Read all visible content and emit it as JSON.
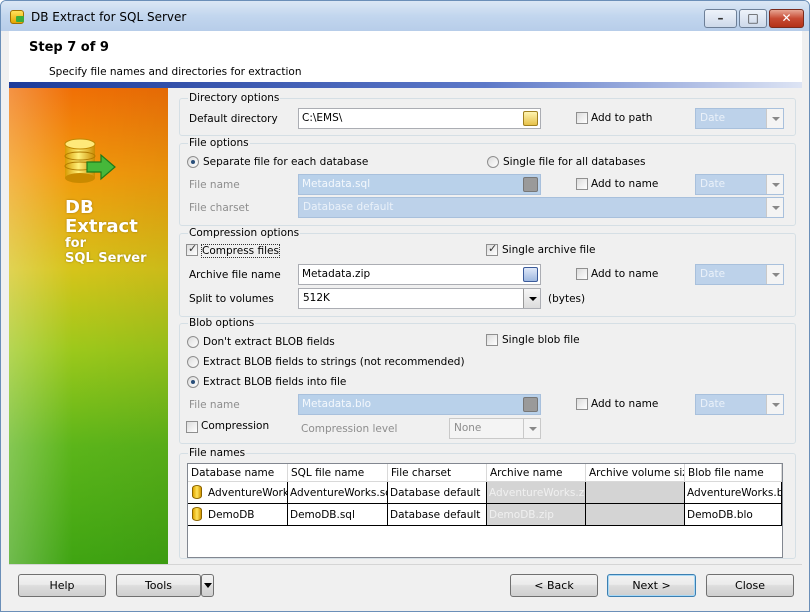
{
  "window": {
    "title": "DB Extract for SQL Server"
  },
  "header": {
    "step": "Step 7 of 9",
    "description": "Specify file names and directories for extraction"
  },
  "banner": {
    "line1": "DB",
    "line2": "Extract",
    "line3": "for",
    "line4": "SQL Server"
  },
  "directory_options": {
    "title": "Directory options",
    "default_directory_label": "Default directory",
    "default_directory_value": "C:\\EMS\\",
    "add_to_path_label": "Add to path",
    "add_to_path_checked": false,
    "date_value": "Date"
  },
  "file_options": {
    "title": "File options",
    "separate_label": "Separate file for each database",
    "single_label": "Single file for all databases",
    "separate_selected": true,
    "file_name_label": "File name",
    "file_name_value": "Metadata.sql",
    "add_to_name_label": "Add to name",
    "date_value": "Date",
    "file_charset_label": "File charset",
    "file_charset_value": "Database default"
  },
  "compression_options": {
    "title": "Compression options",
    "compress_files_label": "Compress files",
    "compress_files_checked": true,
    "single_archive_label": "Single archive file",
    "single_archive_checked": true,
    "archive_file_name_label": "Archive file name",
    "archive_file_name_value": "Metadata.zip",
    "add_to_name_label": "Add to name",
    "date_value": "Date",
    "split_label": "Split to volumes",
    "split_value": "512K",
    "bytes_label": "(bytes)"
  },
  "blob_options": {
    "title": "Blob options",
    "dont_extract_label": "Don't extract BLOB fields",
    "to_strings_label": "Extract BLOB fields to strings (not recommended)",
    "into_file_label": "Extract BLOB fields into file",
    "selected": "into_file",
    "single_blob_label": "Single blob file",
    "file_name_label": "File name",
    "file_name_value": "Metadata.blo",
    "add_to_name_label": "Add to name",
    "date_value": "Date",
    "compression_label": "Compression",
    "compression_level_label": "Compression level",
    "compression_level_value": "None"
  },
  "file_names": {
    "title": "File names",
    "columns": [
      "Database name",
      "SQL file name",
      "File charset",
      "Archive name",
      "Archive volume size",
      "Blob file name"
    ],
    "rows": [
      [
        "AdventureWorks",
        "AdventureWorks.sql",
        "Database default",
        "AdventureWorks.zip",
        "",
        "AdventureWorks.blo"
      ],
      [
        "DemoDB",
        "DemoDB.sql",
        "Database default",
        "DemoDB.zip",
        "",
        "DemoDB.blo"
      ]
    ]
  },
  "footer": {
    "help": "Help",
    "tools": "Tools",
    "back": "< Back",
    "next": "Next >",
    "close": "Close"
  },
  "colors": {
    "accent": "#1d3c9a",
    "disabled_field": "#b9d1ea"
  }
}
